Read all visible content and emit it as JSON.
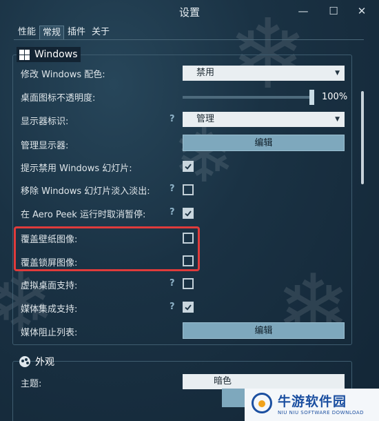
{
  "window": {
    "title": "设置",
    "controls": {
      "minimize": "—",
      "maximize": "☐",
      "close": "✕"
    }
  },
  "tabs": [
    {
      "label": "性能",
      "active": false
    },
    {
      "label": "常规",
      "active": true
    },
    {
      "label": "插件",
      "active": false
    },
    {
      "label": "关于",
      "active": false
    }
  ],
  "windows_section": {
    "title": "Windows",
    "icon": "windows-logo-icon",
    "change_color": {
      "label": "修改 Windows 配色:",
      "value": "禁用"
    },
    "desktop_icon_opacity": {
      "label": "桌面图标不透明度:",
      "value_text": "100%",
      "value_percent": 100
    },
    "display_id": {
      "label": "显示器标识:",
      "help": "?",
      "value": "管理"
    },
    "manage_displays": {
      "label": "管理显示器:",
      "button": "编辑"
    },
    "toggles": [
      {
        "label": "提示禁用 Windows 幻灯片:",
        "help": "",
        "checked": true
      },
      {
        "label": "移除 Windows 幻灯片淡入淡出:",
        "help": "?",
        "checked": false
      },
      {
        "label": "在 Aero Peek 运行时取消暂停:",
        "help": "?",
        "checked": true
      },
      {
        "label": "覆盖壁纸图像:",
        "help": "",
        "checked": false
      },
      {
        "label": "覆盖锁屏图像:",
        "help": "",
        "checked": false
      },
      {
        "label": "虚拟桌面支持:",
        "help": "?",
        "checked": false
      },
      {
        "label": "媒体集成支持:",
        "help": "?",
        "checked": true
      }
    ],
    "media_block_list": {
      "label": "媒体阻止列表:",
      "button": "编辑"
    }
  },
  "appearance_section": {
    "title": "外观",
    "icon": "palette-icon",
    "theme": {
      "label": "主题:",
      "value": "暗色"
    }
  },
  "watermark": {
    "name": "牛游软件园",
    "sub": "NIU NIU SOFTWARE DOWNLOAD"
  },
  "colors": {
    "highlight_border": "#e03b3b",
    "accent_button": "#7ea8bd",
    "background": "#1a3244"
  }
}
